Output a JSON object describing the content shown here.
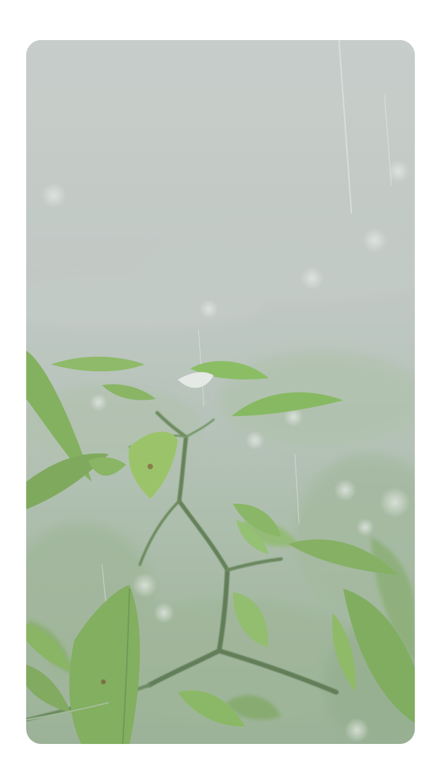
{
  "photo": {
    "subject": "plant-stem-with-green-leaves-in-rain",
    "colors": {
      "mist_top": "#c3c9c6",
      "mist_mid": "#b6c0bb",
      "foliage_haze": "#9fb39a",
      "leaf_light": "#8fbf5a",
      "leaf_mid": "#6fa544",
      "leaf_dark": "#4f7d36",
      "stem": "#4a6b3c"
    }
  }
}
